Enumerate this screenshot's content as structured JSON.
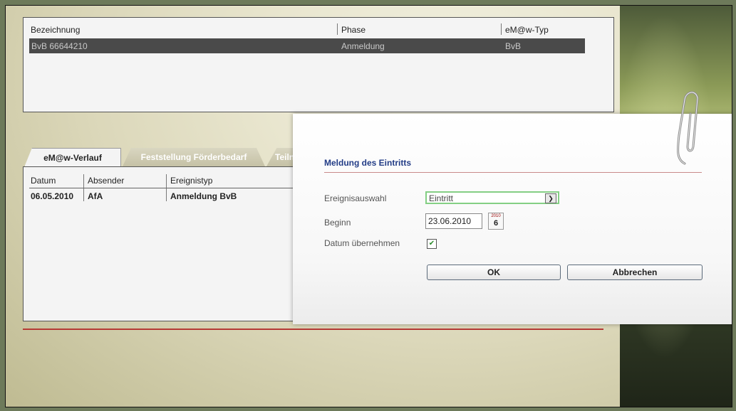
{
  "top_table": {
    "headers": [
      "Bezeichnung",
      "Phase",
      "eM@w-Typ"
    ],
    "row": {
      "bezeichnung": "BvB 66644210",
      "phase": "Anmeldung",
      "typ": "BvB"
    }
  },
  "tabs": [
    {
      "label": "eM@w-Verlauf",
      "active": true
    },
    {
      "label": "Feststellung Förderbedarf",
      "active": false
    },
    {
      "label": "Teiln",
      "active": false
    }
  ],
  "bottom_table": {
    "headers": [
      "Datum",
      "Absender",
      "Ereignistyp"
    ],
    "rows": [
      {
        "datum": "06.05.2010",
        "absender": "AfA",
        "ereignistyp": "Anmeldung BvB"
      }
    ]
  },
  "dialog": {
    "title": "Meldung des Eintritts",
    "ereignisauswahl_label": "Ereignisauswahl",
    "ereignisauswahl_value": "Eintritt",
    "beginn_label": "Beginn",
    "beginn_value": "23.06.2010",
    "calendar_year": "2010",
    "calendar_day": "6",
    "datum_label": "Datum übernehmen",
    "datum_checked": true,
    "ok_label": "OK",
    "cancel_label": "Abbrechen"
  },
  "colors": {
    "dialog_title": "#223c86",
    "selected_row": "#4a4a4a",
    "red_rule": "#b53a35",
    "select_focus": "#84cf84"
  }
}
